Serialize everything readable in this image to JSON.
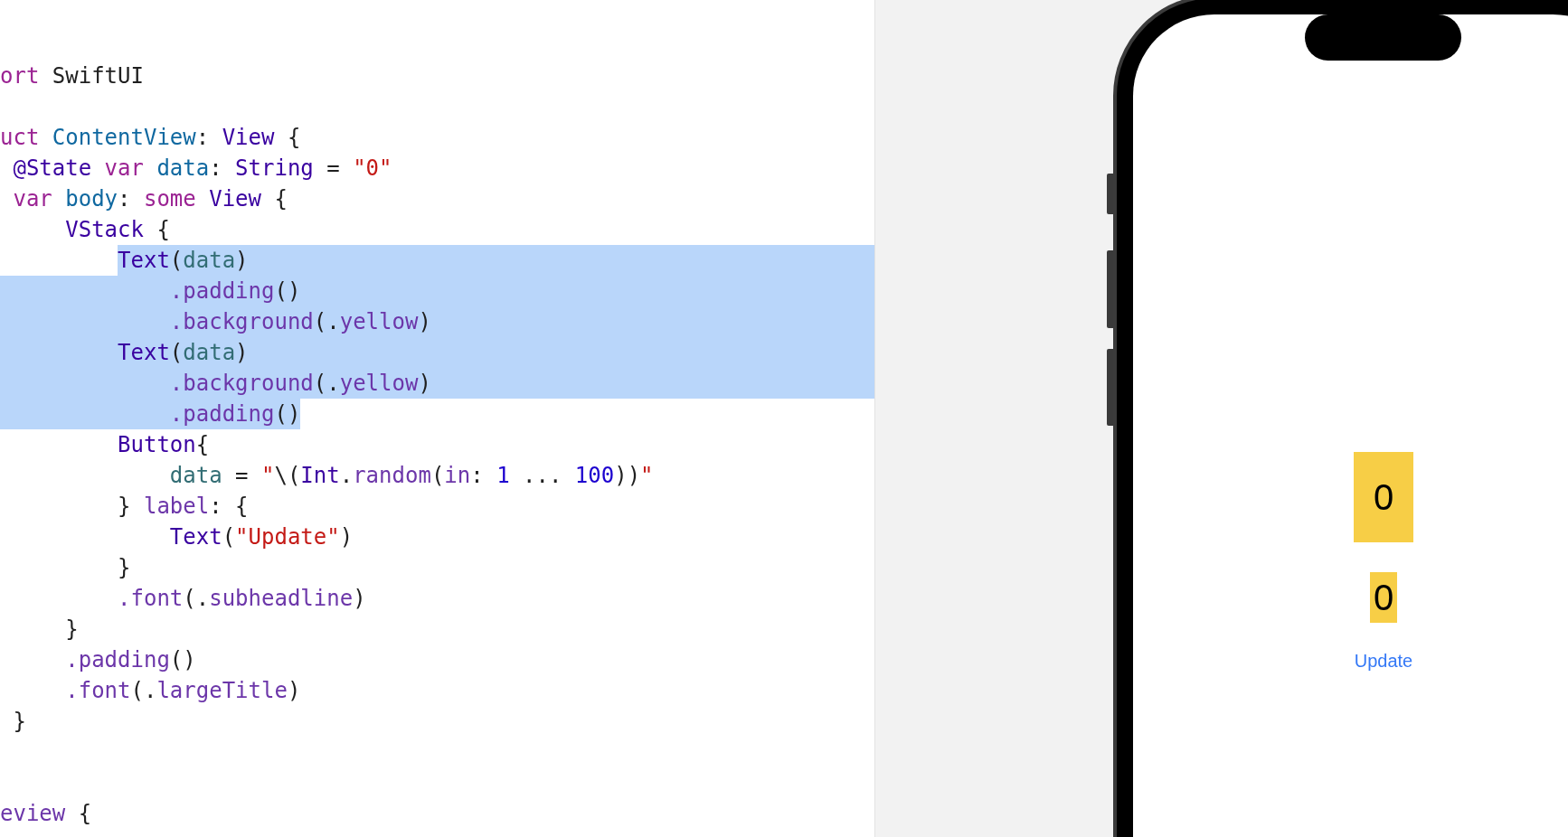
{
  "editor": {
    "lines": [
      {
        "kind": "code",
        "selected": false,
        "tokens": [
          {
            "text": "ort",
            "kind": "keyword"
          },
          {
            "text": " SwiftUI",
            "kind": "plain"
          }
        ]
      },
      {
        "kind": "blank"
      },
      {
        "kind": "code",
        "selected": false,
        "tokens": [
          {
            "text": "uct",
            "kind": "keyword"
          },
          {
            "text": " ContentView",
            "kind": "decl"
          },
          {
            "text": ": ",
            "kind": "plain"
          },
          {
            "text": "View",
            "kind": "type"
          },
          {
            "text": " {",
            "kind": "plain"
          }
        ]
      },
      {
        "kind": "code",
        "selected": false,
        "tokens": [
          {
            "text": " @State",
            "kind": "type"
          },
          {
            "text": " var",
            "kind": "keyword"
          },
          {
            "text": " data",
            "kind": "decl"
          },
          {
            "text": ": ",
            "kind": "plain"
          },
          {
            "text": "String",
            "kind": "type"
          },
          {
            "text": " = ",
            "kind": "plain"
          },
          {
            "text": "\"0\"",
            "kind": "string"
          }
        ]
      },
      {
        "kind": "code",
        "selected": false,
        "tokens": [
          {
            "text": " var",
            "kind": "keyword"
          },
          {
            "text": " body",
            "kind": "decl"
          },
          {
            "text": ": ",
            "kind": "plain"
          },
          {
            "text": "some",
            "kind": "keyword"
          },
          {
            "text": " View",
            "kind": "type"
          },
          {
            "text": " {",
            "kind": "plain"
          }
        ]
      },
      {
        "kind": "code",
        "selected": false,
        "tokens": [
          {
            "text": "     VStack",
            "kind": "type"
          },
          {
            "text": " {",
            "kind": "plain"
          }
        ]
      },
      {
        "kind": "code",
        "selected": true,
        "tokens": [
          {
            "text": "         Text",
            "kind": "type"
          },
          {
            "text": "(",
            "kind": "plain"
          },
          {
            "text": "data",
            "kind": "property"
          },
          {
            "text": ")",
            "kind": "plain"
          }
        ]
      },
      {
        "kind": "code",
        "selected": true,
        "tokens": [
          {
            "text": "             .padding",
            "kind": "method"
          },
          {
            "text": "()",
            "kind": "plain"
          }
        ]
      },
      {
        "kind": "code",
        "selected": true,
        "tokens": [
          {
            "text": "             .background",
            "kind": "method"
          },
          {
            "text": "(.",
            "kind": "plain"
          },
          {
            "text": "yellow",
            "kind": "method"
          },
          {
            "text": ")",
            "kind": "plain"
          }
        ]
      },
      {
        "kind": "code",
        "selected": true,
        "tokens": [
          {
            "text": "         Text",
            "kind": "type"
          },
          {
            "text": "(",
            "kind": "plain"
          },
          {
            "text": "data",
            "kind": "property"
          },
          {
            "text": ")",
            "kind": "plain"
          }
        ]
      },
      {
        "kind": "code",
        "selected": true,
        "tokens": [
          {
            "text": "             .background",
            "kind": "method"
          },
          {
            "text": "(.",
            "kind": "plain"
          },
          {
            "text": "yellow",
            "kind": "method"
          },
          {
            "text": ")",
            "kind": "plain"
          }
        ]
      },
      {
        "kind": "code",
        "selected": true,
        "tokens": [
          {
            "text": "             .padding",
            "kind": "method"
          },
          {
            "text": "()",
            "kind": "plain"
          }
        ]
      },
      {
        "kind": "code",
        "selected": false,
        "tokens": [
          {
            "text": "         Button",
            "kind": "type"
          },
          {
            "text": "{",
            "kind": "plain"
          }
        ]
      },
      {
        "kind": "code",
        "selected": false,
        "tokens": [
          {
            "text": "             data",
            "kind": "property"
          },
          {
            "text": " = ",
            "kind": "plain"
          },
          {
            "text": "\"",
            "kind": "string"
          },
          {
            "text": "\\(",
            "kind": "plain"
          },
          {
            "text": "Int",
            "kind": "type"
          },
          {
            "text": ".",
            "kind": "plain"
          },
          {
            "text": "random",
            "kind": "method"
          },
          {
            "text": "(",
            "kind": "plain"
          },
          {
            "text": "in",
            "kind": "method"
          },
          {
            "text": ": ",
            "kind": "plain"
          },
          {
            "text": "1",
            "kind": "number"
          },
          {
            "text": " ... ",
            "kind": "plain"
          },
          {
            "text": "100",
            "kind": "number"
          },
          {
            "text": "))",
            "kind": "plain"
          },
          {
            "text": "\"",
            "kind": "string"
          }
        ]
      },
      {
        "kind": "code",
        "selected": false,
        "tokens": [
          {
            "text": "         } ",
            "kind": "plain"
          },
          {
            "text": "label",
            "kind": "method"
          },
          {
            "text": ": {",
            "kind": "plain"
          }
        ]
      },
      {
        "kind": "code",
        "selected": false,
        "tokens": [
          {
            "text": "             Text",
            "kind": "type"
          },
          {
            "text": "(",
            "kind": "plain"
          },
          {
            "text": "\"Update\"",
            "kind": "string"
          },
          {
            "text": ")",
            "kind": "plain"
          }
        ]
      },
      {
        "kind": "code",
        "selected": false,
        "tokens": [
          {
            "text": "         }",
            "kind": "plain"
          }
        ]
      },
      {
        "kind": "code",
        "selected": false,
        "tokens": [
          {
            "text": "         .font",
            "kind": "method"
          },
          {
            "text": "(.",
            "kind": "plain"
          },
          {
            "text": "subheadline",
            "kind": "method"
          },
          {
            "text": ")",
            "kind": "plain"
          }
        ]
      },
      {
        "kind": "code",
        "selected": false,
        "tokens": [
          {
            "text": "     }",
            "kind": "plain"
          }
        ]
      },
      {
        "kind": "code",
        "selected": false,
        "tokens": [
          {
            "text": "     .padding",
            "kind": "method"
          },
          {
            "text": "()",
            "kind": "plain"
          }
        ]
      },
      {
        "kind": "code",
        "selected": false,
        "tokens": [
          {
            "text": "     .font",
            "kind": "method"
          },
          {
            "text": "(.",
            "kind": "plain"
          },
          {
            "text": "largeTitle",
            "kind": "method"
          },
          {
            "text": ")",
            "kind": "plain"
          }
        ]
      },
      {
        "kind": "code",
        "selected": false,
        "tokens": [
          {
            "text": " }",
            "kind": "plain"
          }
        ]
      },
      {
        "kind": "blank"
      },
      {
        "kind": "blank"
      },
      {
        "kind": "code",
        "selected": false,
        "tokens": [
          {
            "text": "eview",
            "kind": "method"
          },
          {
            "text": " {",
            "kind": "plain"
          }
        ]
      }
    ]
  },
  "preview": {
    "text_views": [
      {
        "text": "0",
        "kind": "padded"
      },
      {
        "text": "0",
        "kind": "tight"
      }
    ],
    "button": {
      "label": "Update"
    }
  }
}
